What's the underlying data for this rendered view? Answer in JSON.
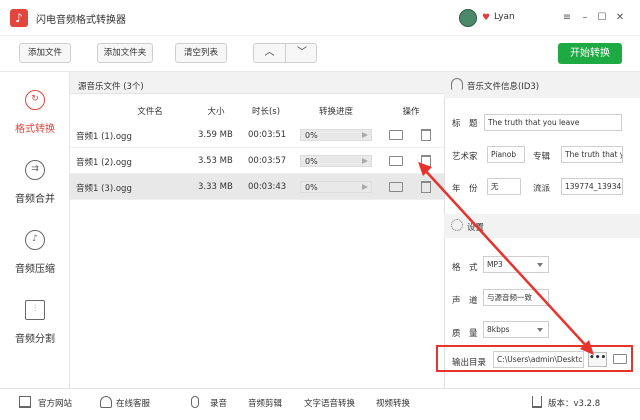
{
  "app": {
    "title": "闪电音频格式转换器",
    "username": "Lyan",
    "logo_glyph": "♪"
  },
  "window": {
    "minimize": "–",
    "restore": "☐",
    "maximize": "☐",
    "close": "✕",
    "menu": "≡"
  },
  "toolbar": {
    "add_file": "添加文件",
    "add_folder": "添加文件夹",
    "clear_list": "清空列表",
    "up_arrow": "︿",
    "down_arrow": "﹀",
    "start": "开始转换"
  },
  "sidebar": {
    "items": [
      {
        "label": "格式转换",
        "icon": "refresh-icon",
        "glyph": "↻",
        "active": true
      },
      {
        "label": "音频合并",
        "icon": "merge-icon",
        "glyph": "⇉",
        "active": false
      },
      {
        "label": "音频压缩",
        "icon": "compress-icon",
        "glyph": "♪",
        "active": false
      },
      {
        "label": "音频分割",
        "icon": "split-icon",
        "glyph": "⫶",
        "active": false
      }
    ]
  },
  "filelist": {
    "title": "源音乐文件 (3个)",
    "columns": {
      "name": "文件名",
      "size": "大小",
      "duration": "时长(s)",
      "progress": "转换进度",
      "actions": "操作"
    },
    "rows": [
      {
        "name": "音频1 (1).ogg",
        "size": "3.59 MB",
        "duration": "00:03:51",
        "progress": "0%",
        "selected": false
      },
      {
        "name": "音频1 (2).ogg",
        "size": "3.53 MB",
        "duration": "00:03:57",
        "progress": "0%",
        "selected": false
      },
      {
        "name": "音频1 (3).ogg",
        "size": "3.33 MB",
        "duration": "00:03:43",
        "progress": "0%",
        "selected": true
      }
    ]
  },
  "id3": {
    "heading": "音乐文件信息(ID3)",
    "title_label": "标　题",
    "title_value": "The truth that you leave",
    "artist_label": "艺术家",
    "artist_value": "Pianob",
    "album_label": "专辑",
    "album_value": "The truth that y",
    "year_label": "年　份",
    "year_value": "无",
    "genre_label": "流派",
    "genre_value": "139774_13934"
  },
  "settings": {
    "heading": "设置",
    "format_label": "格　式",
    "format_value": "MP3",
    "channel_label": "声　道",
    "channel_value": "与源音频一致",
    "quality_label": "质　量",
    "quality_value": "8kbps",
    "output_label": "输出目录",
    "output_value": "C:\\Users\\admin\\Desktc",
    "browse": "•••"
  },
  "bottombar": {
    "official_site": "官方网站",
    "online_service": "在线客服",
    "record": "录音",
    "audio_edit": "音频剪辑",
    "tts": "文字语音转换",
    "video_convert": "视频转换",
    "version": "版本：v3.2.8"
  },
  "colors": {
    "accent": "#e2453c",
    "start_green": "#1eaa43",
    "highlight_red": "#e8322c"
  }
}
